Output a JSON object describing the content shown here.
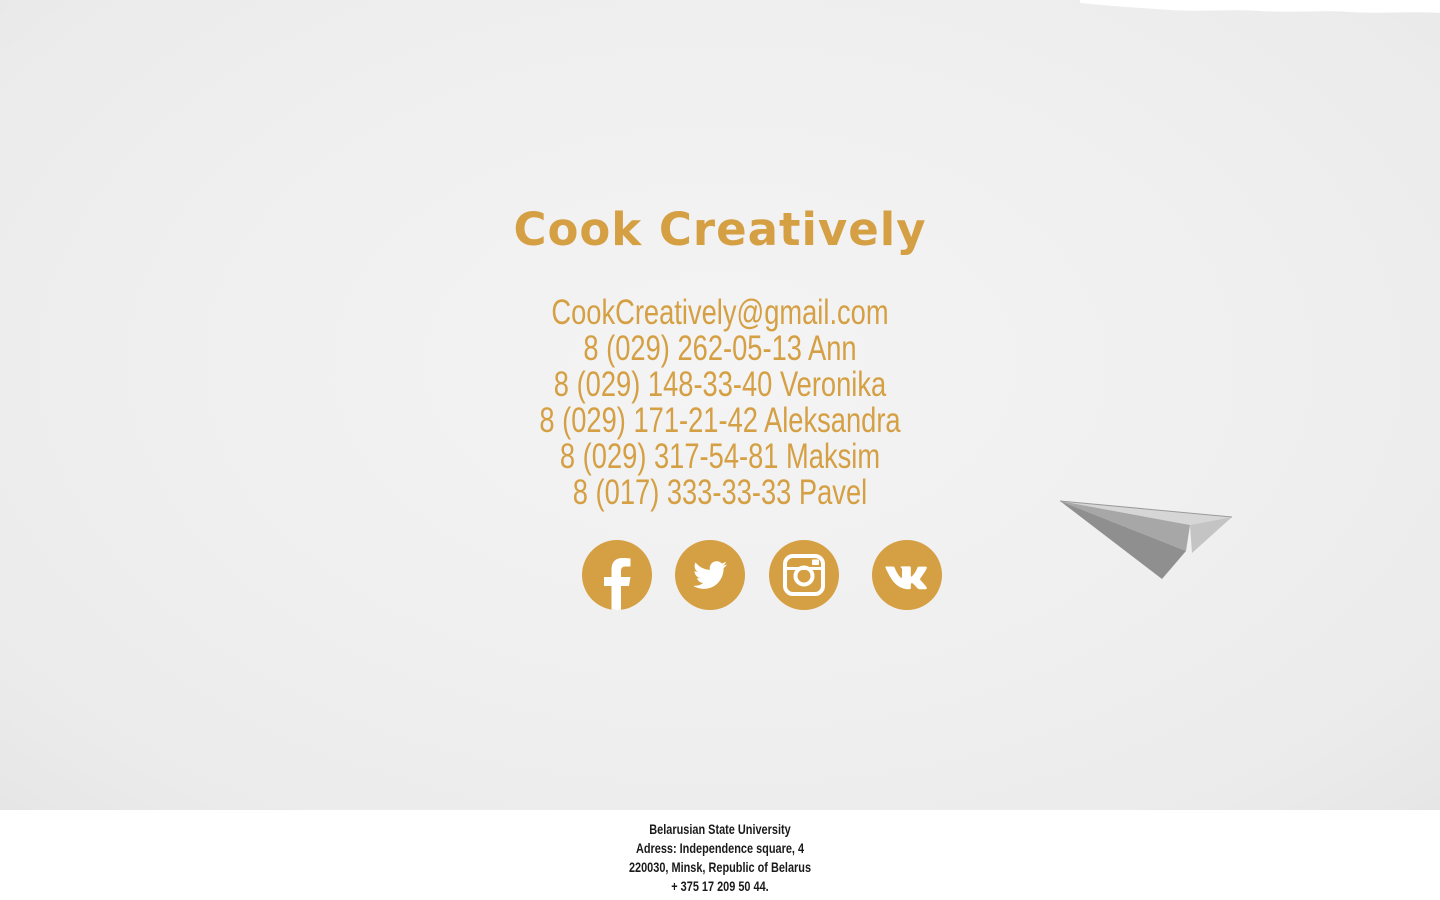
{
  "hero": {
    "title": "Cook Creatively",
    "email": "CookCreatively@gmail.com",
    "phones": [
      "8 (029) 262-05-13 Ann",
      "8 (029) 148-33-40 Veronika",
      "8 (029) 171-21-42 Aleksandra",
      "8 (029) 317-54-81 Maksim",
      "8 (017) 333-33-33 Pavel"
    ],
    "social_icons": [
      "facebook-icon",
      "twitter-icon",
      "instagram-icon",
      "vk-icon"
    ]
  },
  "footer": {
    "lines": [
      "Belarusian State University",
      "Adress: Independence square, 4",
      "220030, Minsk, Republic of Belarus",
      "+ 375 17 209 50 44."
    ]
  },
  "colors": {
    "accent": "#d59f43",
    "background": "#efefef",
    "footer_background": "#ffffff",
    "footer_text": "#1a1a1a"
  }
}
